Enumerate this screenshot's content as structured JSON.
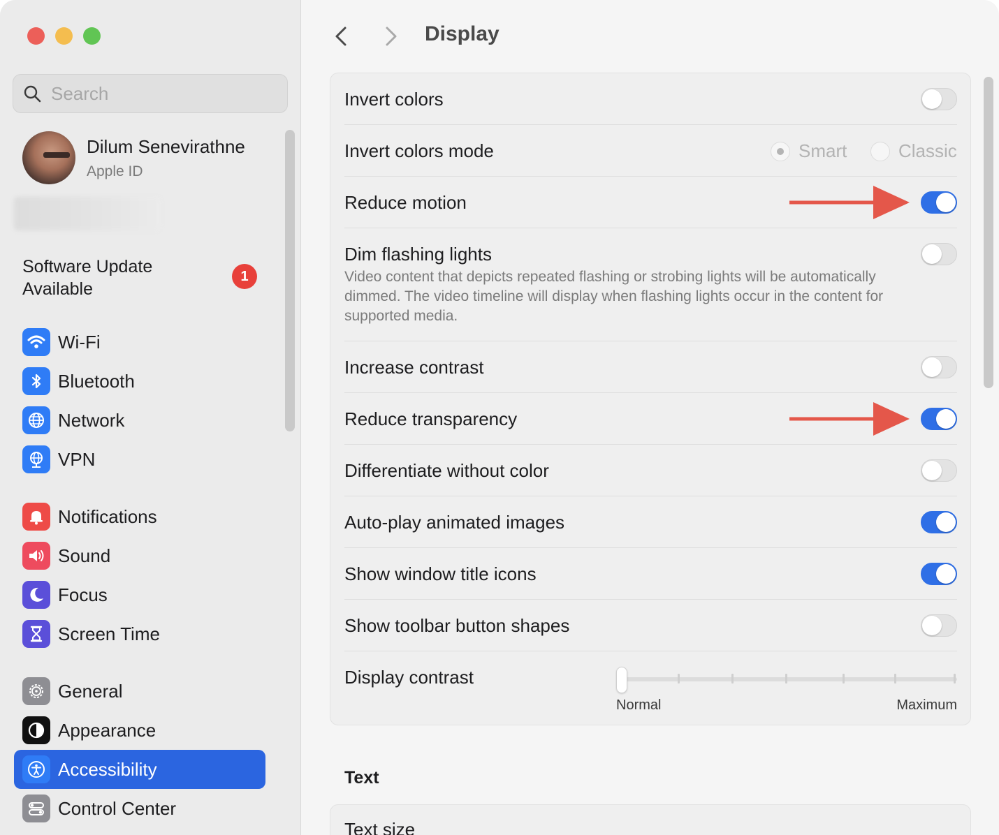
{
  "sidebar": {
    "search_placeholder": "Search",
    "profile": {
      "name": "Dilum Senevirathne",
      "subtitle": "Apple ID"
    },
    "update": {
      "label": "Software Update Available",
      "badge": "1"
    },
    "items": [
      {
        "label": "Wi-Fi",
        "icon": "wifi-icon",
        "color": "#2f7cf6"
      },
      {
        "label": "Bluetooth",
        "icon": "bluetooth-icon",
        "color": "#2f7cf6"
      },
      {
        "label": "Network",
        "icon": "globe-icon",
        "color": "#2f7cf6"
      },
      {
        "label": "VPN",
        "icon": "vpn-globe-icon",
        "color": "#2f7cf6"
      },
      {
        "label": "Notifications",
        "icon": "bell-icon",
        "color": "#ee4b47"
      },
      {
        "label": "Sound",
        "icon": "speaker-icon",
        "color": "#ee4b5e"
      },
      {
        "label": "Focus",
        "icon": "moon-icon",
        "color": "#5b4fd9"
      },
      {
        "label": "Screen Time",
        "icon": "hourglass-icon",
        "color": "#5b4fd9"
      },
      {
        "label": "General",
        "icon": "gear-icon",
        "color": "#8e8e93"
      },
      {
        "label": "Appearance",
        "icon": "appearance-icon",
        "color": "#111111"
      },
      {
        "label": "Accessibility",
        "icon": "accessibility-icon",
        "color": "#2f7cf6",
        "selected": true
      },
      {
        "label": "Control Center",
        "icon": "control-center-icon",
        "color": "#8e8e93"
      }
    ]
  },
  "header": {
    "title": "Display"
  },
  "display": {
    "invert_colors": {
      "label": "Invert colors",
      "on": false
    },
    "invert_mode": {
      "label": "Invert colors mode",
      "options": [
        "Smart",
        "Classic"
      ],
      "selected": "Smart"
    },
    "reduce_motion": {
      "label": "Reduce motion",
      "on": true
    },
    "dim_flashing": {
      "label": "Dim flashing lights",
      "description": "Video content that depicts repeated flashing or strobing lights will be automatically dimmed. The video timeline will display when flashing lights occur in the content for supported media.",
      "on": false
    },
    "increase_contrast": {
      "label": "Increase contrast",
      "on": false
    },
    "reduce_transparency": {
      "label": "Reduce transparency",
      "on": true
    },
    "differentiate": {
      "label": "Differentiate without color",
      "on": false
    },
    "autoplay": {
      "label": "Auto-play animated images",
      "on": true
    },
    "title_icons": {
      "label": "Show window title icons",
      "on": true
    },
    "toolbar_shapes": {
      "label": "Show toolbar button shapes",
      "on": false
    },
    "display_contrast": {
      "label": "Display contrast",
      "min_label": "Normal",
      "max_label": "Maximum",
      "value": 0
    }
  },
  "text_section": {
    "title": "Text",
    "first_row": "Text size"
  },
  "colors": {
    "accent": "#2f6fe6",
    "arrow": "#e4574a"
  }
}
